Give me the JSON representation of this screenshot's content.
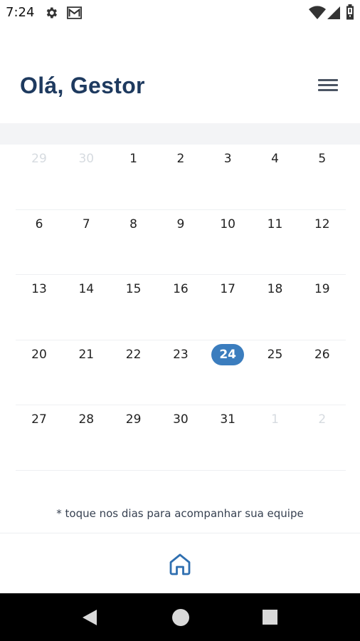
{
  "status_bar": {
    "time": "7:24",
    "icons": [
      "settings-icon",
      "mail-icon",
      "wifi-icon",
      "signal-icon",
      "battery-icon"
    ]
  },
  "header": {
    "greeting": "Olá, Gestor",
    "menu_icon": "hamburger-menu-icon"
  },
  "calendar": {
    "weeks": [
      [
        {
          "d": "29",
          "muted": true
        },
        {
          "d": "30",
          "muted": true
        },
        {
          "d": "1"
        },
        {
          "d": "2"
        },
        {
          "d": "3"
        },
        {
          "d": "4"
        },
        {
          "d": "5"
        }
      ],
      [
        {
          "d": "6"
        },
        {
          "d": "7"
        },
        {
          "d": "8"
        },
        {
          "d": "9"
        },
        {
          "d": "10"
        },
        {
          "d": "11"
        },
        {
          "d": "12"
        }
      ],
      [
        {
          "d": "13"
        },
        {
          "d": "14"
        },
        {
          "d": "15"
        },
        {
          "d": "16"
        },
        {
          "d": "17"
        },
        {
          "d": "18"
        },
        {
          "d": "19"
        }
      ],
      [
        {
          "d": "20"
        },
        {
          "d": "21"
        },
        {
          "d": "22"
        },
        {
          "d": "23"
        },
        {
          "d": "24",
          "selected": true
        },
        {
          "d": "25"
        },
        {
          "d": "26"
        }
      ],
      [
        {
          "d": "27"
        },
        {
          "d": "28"
        },
        {
          "d": "29"
        },
        {
          "d": "30"
        },
        {
          "d": "31"
        },
        {
          "d": "1",
          "muted": true
        },
        {
          "d": "2",
          "muted": true
        }
      ]
    ],
    "selected_color": "#3b7dbe"
  },
  "hint": "* toque nos dias para acompanhar sua equipe",
  "tabbar": {
    "home_icon": "home-icon",
    "accent": "#2f6fb0"
  },
  "navbar": {
    "icons": [
      "back-icon",
      "home-circle-icon",
      "recents-icon"
    ]
  }
}
